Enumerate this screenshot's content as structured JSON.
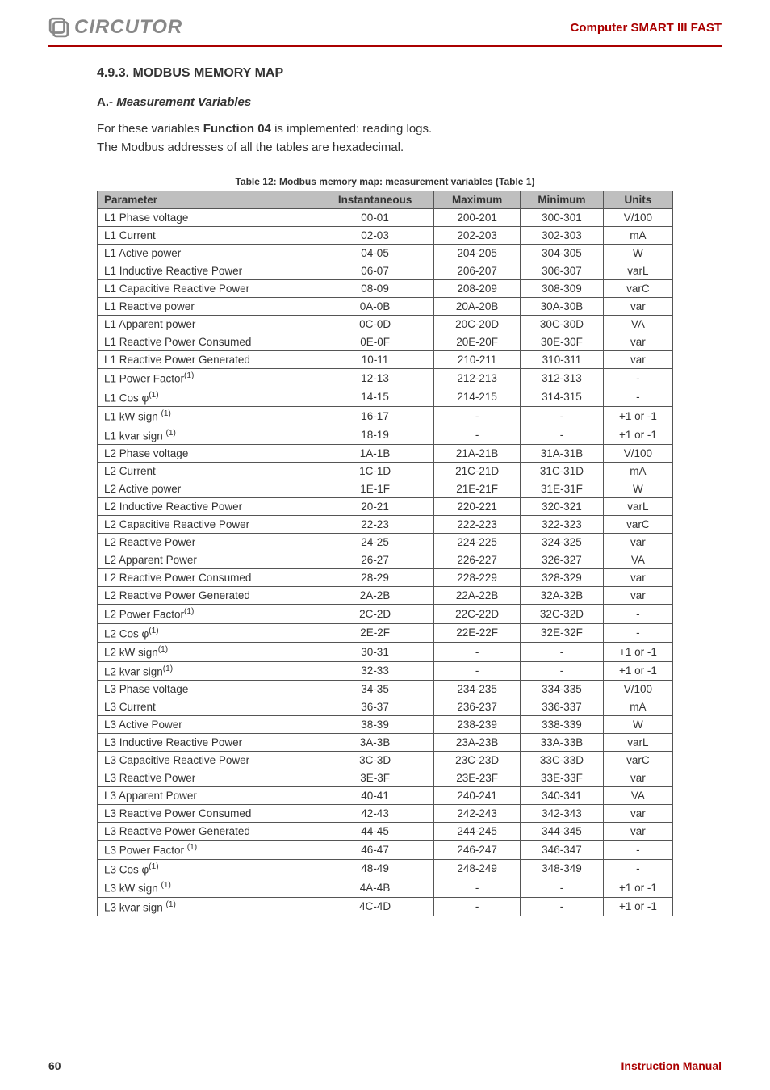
{
  "header": {
    "logo_text": "CIRCUTOR",
    "doc_title": "Computer SMART III FAST"
  },
  "section": {
    "heading": "4.9.3. MODBUS MEMORY MAP",
    "sub_prefix": "A",
    "sub_sep": ".- ",
    "sub_italic": "Measurement Variables",
    "body_line1_a": "For these variables ",
    "body_line1_b": "Function 04",
    "body_line1_c": " is implemented: reading logs.",
    "body_line2": "The Modbus addresses of all the tables are hexadecimal."
  },
  "table": {
    "caption": "Table 12: Modbus memory map: measurement variables (Table 1)",
    "headers": [
      "Parameter",
      "Instantaneous",
      "Maximum",
      "Minimum",
      "Units"
    ],
    "rows": [
      {
        "p": "L1 Phase voltage",
        "sup": "",
        "i": "00-01",
        "x": "200-201",
        "n": "300-301",
        "u": "V/100"
      },
      {
        "p": "L1 Current",
        "sup": "",
        "i": "02-03",
        "x": "202-203",
        "n": "302-303",
        "u": "mA"
      },
      {
        "p": "L1 Active power",
        "sup": "",
        "i": "04-05",
        "x": "204-205",
        "n": "304-305",
        "u": "W"
      },
      {
        "p": "L1 Inductive Reactive Power",
        "sup": "",
        "i": "06-07",
        "x": "206-207",
        "n": "306-307",
        "u": "varL"
      },
      {
        "p": "L1 Capacitive Reactive Power",
        "sup": "",
        "i": "08-09",
        "x": "208-209",
        "n": "308-309",
        "u": "varC"
      },
      {
        "p": "L1 Reactive power",
        "sup": "",
        "i": "0A-0B",
        "x": "20A-20B",
        "n": "30A-30B",
        "u": "var"
      },
      {
        "p": "L1 Apparent power",
        "sup": "",
        "i": "0C-0D",
        "x": "20C-20D",
        "n": "30C-30D",
        "u": "VA"
      },
      {
        "p": "L1 Reactive Power Consumed",
        "sup": "",
        "i": "0E-0F",
        "x": "20E-20F",
        "n": "30E-30F",
        "u": "var"
      },
      {
        "p": "L1 Reactive Power Generated",
        "sup": "",
        "i": "10-11",
        "x": "210-211",
        "n": "310-311",
        "u": "var"
      },
      {
        "p": "L1 Power Factor",
        "sup": "(1)",
        "i": "12-13",
        "x": "212-213",
        "n": "312-313",
        "u": "-"
      },
      {
        "p": "L1 Cos φ",
        "sup": "(1)",
        "i": "14-15",
        "x": "214-215",
        "n": "314-315",
        "u": "-"
      },
      {
        "p": "L1 kW sign ",
        "sup": "(1)",
        "i": "16-17",
        "x": "-",
        "n": "-",
        "u": "+1 or -1"
      },
      {
        "p": "L1 kvar sign ",
        "sup": "(1)",
        "i": "18-19",
        "x": "-",
        "n": "-",
        "u": "+1 or -1"
      },
      {
        "p": "L2 Phase voltage",
        "sup": "",
        "i": "1A-1B",
        "x": "21A-21B",
        "n": "31A-31B",
        "u": "V/100"
      },
      {
        "p": "L2 Current",
        "sup": "",
        "i": "1C-1D",
        "x": "21C-21D",
        "n": "31C-31D",
        "u": "mA"
      },
      {
        "p": "L2 Active power",
        "sup": "",
        "i": "1E-1F",
        "x": "21E-21F",
        "n": "31E-31F",
        "u": "W"
      },
      {
        "p": "L2 Inductive Reactive Power",
        "sup": "",
        "i": "20-21",
        "x": "220-221",
        "n": "320-321",
        "u": "varL"
      },
      {
        "p": "L2 Capacitive Reactive Power",
        "sup": "",
        "i": "22-23",
        "x": "222-223",
        "n": "322-323",
        "u": "varC"
      },
      {
        "p": "L2 Reactive Power",
        "sup": "",
        "i": "24-25",
        "x": "224-225",
        "n": "324-325",
        "u": "var"
      },
      {
        "p": "L2 Apparent Power",
        "sup": "",
        "i": "26-27",
        "x": "226-227",
        "n": "326-327",
        "u": "VA"
      },
      {
        "p": "L2 Reactive Power Consumed",
        "sup": "",
        "i": "28-29",
        "x": "228-229",
        "n": "328-329",
        "u": "var"
      },
      {
        "p": "L2 Reactive Power Generated",
        "sup": "",
        "i": "2A-2B",
        "x": "22A-22B",
        "n": "32A-32B",
        "u": "var"
      },
      {
        "p": "L2 Power Factor",
        "sup": "(1)",
        "i": "2C-2D",
        "x": "22C-22D",
        "n": "32C-32D",
        "u": "-"
      },
      {
        "p": "L2 Cos φ",
        "sup": "(1)",
        "i": "2E-2F",
        "x": "22E-22F",
        "n": "32E-32F",
        "u": "-"
      },
      {
        "p": "L2 kW sign",
        "sup": "(1)",
        "i": "30-31",
        "x": "-",
        "n": "-",
        "u": "+1 or -1"
      },
      {
        "p": "L2 kvar sign",
        "sup": "(1)",
        "i": "32-33",
        "x": "-",
        "n": "-",
        "u": "+1 or -1"
      },
      {
        "p": "L3 Phase voltage",
        "sup": "",
        "i": "34-35",
        "x": "234-235",
        "n": "334-335",
        "u": "V/100"
      },
      {
        "p": "L3 Current",
        "sup": "",
        "i": "36-37",
        "x": "236-237",
        "n": "336-337",
        "u": "mA"
      },
      {
        "p": "L3 Active Power",
        "sup": "",
        "i": "38-39",
        "x": "238-239",
        "n": "338-339",
        "u": "W"
      },
      {
        "p": "L3 Inductive Reactive Power",
        "sup": "",
        "i": "3A-3B",
        "x": "23A-23B",
        "n": "33A-33B",
        "u": "varL"
      },
      {
        "p": "L3 Capacitive Reactive Power",
        "sup": "",
        "i": "3C-3D",
        "x": "23C-23D",
        "n": "33C-33D",
        "u": "varC"
      },
      {
        "p": "L3 Reactive Power",
        "sup": "",
        "i": "3E-3F",
        "x": "23E-23F",
        "n": "33E-33F",
        "u": "var"
      },
      {
        "p": "L3 Apparent Power",
        "sup": "",
        "i": "40-41",
        "x": "240-241",
        "n": "340-341",
        "u": "VA"
      },
      {
        "p": "L3 Reactive Power Consumed",
        "sup": "",
        "i": "42-43",
        "x": "242-243",
        "n": "342-343",
        "u": "var"
      },
      {
        "p": "L3 Reactive Power Generated",
        "sup": "",
        "i": "44-45",
        "x": "244-245",
        "n": "344-345",
        "u": "var"
      },
      {
        "p": "L3 Power Factor ",
        "sup": "(1)",
        "i": "46-47",
        "x": "246-247",
        "n": "346-347",
        "u": "-"
      },
      {
        "p": "L3 Cos φ",
        "sup": "(1)",
        "i": "48-49",
        "x": "248-249",
        "n": "348-349",
        "u": "-"
      },
      {
        "p": "L3 kW sign ",
        "sup": "(1)",
        "i": "4A-4B",
        "x": "-",
        "n": "-",
        "u": "+1 or -1"
      },
      {
        "p": "L3 kvar sign ",
        "sup": "(1)",
        "i": "4C-4D",
        "x": "-",
        "n": "-",
        "u": "+1 or -1"
      }
    ]
  },
  "footer": {
    "page": "60",
    "label": "Instruction Manual"
  }
}
